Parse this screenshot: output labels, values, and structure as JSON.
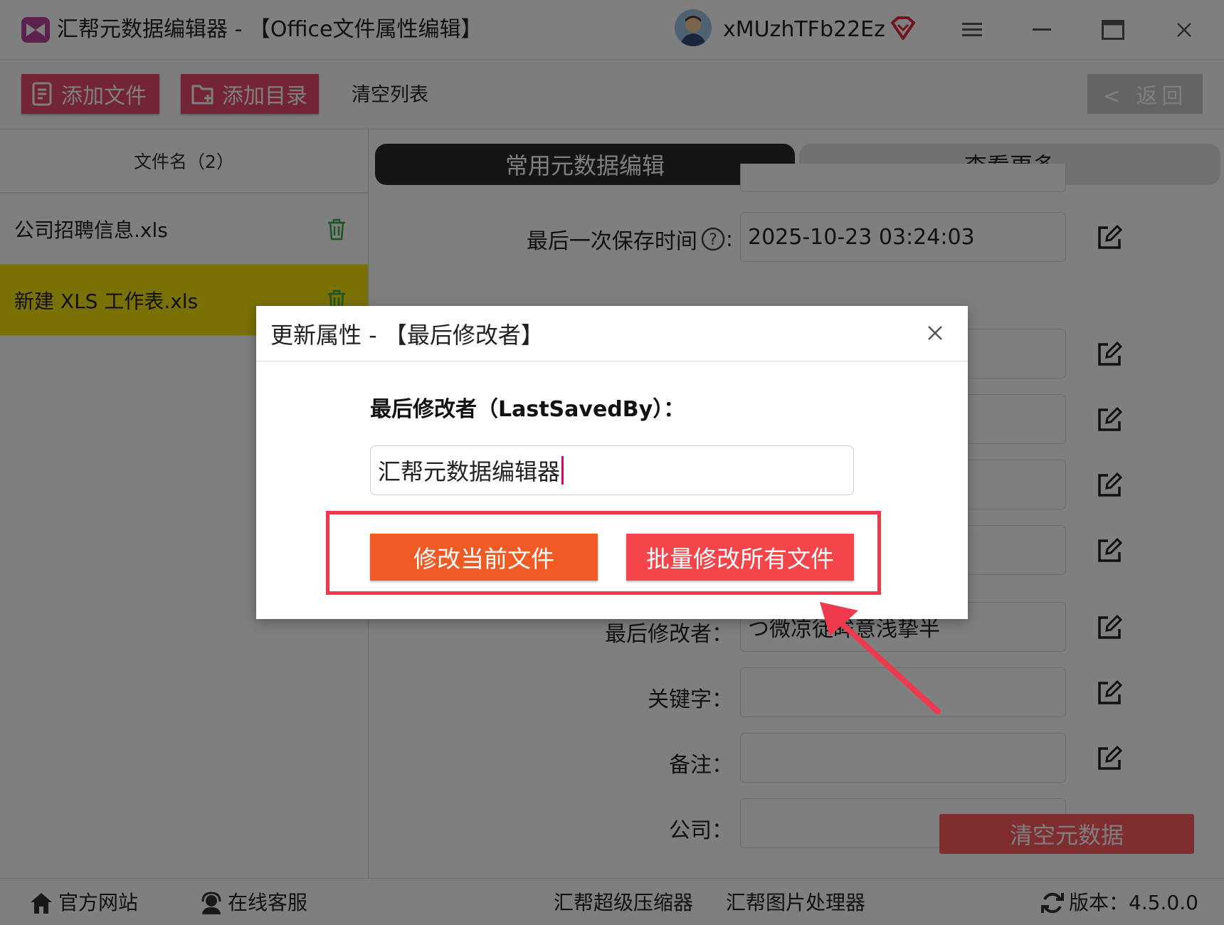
{
  "window": {
    "title": "汇帮元数据编辑器 - 【Office文件属性编辑】",
    "username": "xMUzhTFb22Ez",
    "controls": [
      "menu",
      "minimize",
      "maximize",
      "close"
    ]
  },
  "toolbar": {
    "add_file": "添加文件",
    "add_folder": "添加目录",
    "clear_list": "清空列表",
    "back": "< 返回"
  },
  "sidebar": {
    "header": "文件名（2）",
    "files": [
      {
        "name": "公司招聘信息.xls",
        "selected": false
      },
      {
        "name": "新建 XLS 工作表.xls",
        "selected": true
      }
    ]
  },
  "tabs": {
    "active": "常用元数据编辑",
    "inactive": "查看更多"
  },
  "fields": {
    "last_save_time_label": "最后一次保存时间",
    "last_save_time_value": "2025-10-23 03:24:03",
    "last_modifier_label": "最后修改者：",
    "last_modifier_value": "つ微凉徒眸意浅挚半",
    "keywords_label": "关键字：",
    "notes_label": "备注：",
    "company_label": "公司："
  },
  "clear_metadata": "清空元数据",
  "footer": {
    "website": "官方网站",
    "support": "在线客服",
    "compressor": "汇帮超级压缩器",
    "image_tool": "汇帮图片处理器",
    "version": "版本：4.5.0.0"
  },
  "dialog": {
    "title": "更新属性 - 【最后修改者】",
    "field_label": "最后修改者（LastSavedBy）：",
    "input_value": "汇帮元数据编辑器",
    "btn_current": "修改当前文件",
    "btn_batch": "批量修改所有文件"
  },
  "colors": {
    "accent_pink": "#e84a6a",
    "selected_row": "#f5e20b",
    "btn_current": "#f05a24",
    "btn_batch": "#f5444a",
    "highlight": "#ef3a4e"
  }
}
